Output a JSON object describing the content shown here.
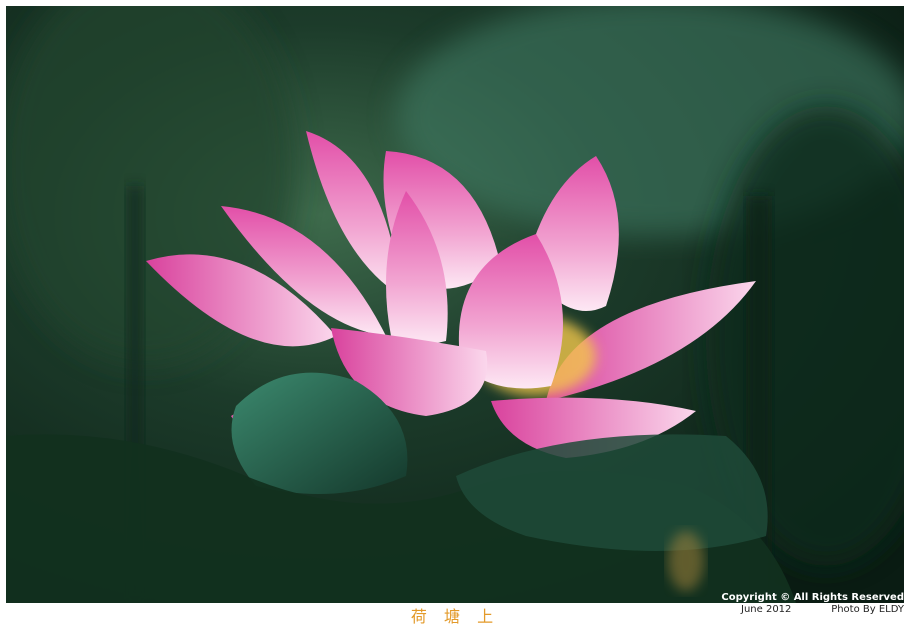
{
  "photo": {
    "subject": "pink lotus flower among green lotus leaves",
    "colors": {
      "background": "#123021",
      "leaf": "#2e6f5a",
      "petal_light": "#fbe4f3",
      "petal_dark": "#d6459e",
      "stamen": "#f3c84c"
    }
  },
  "watermark": {
    "copyright": "Copyright © All Rights Reserved",
    "date": "June 2012",
    "credit": "Photo By ELDY"
  },
  "caption": "荷 塘 上"
}
